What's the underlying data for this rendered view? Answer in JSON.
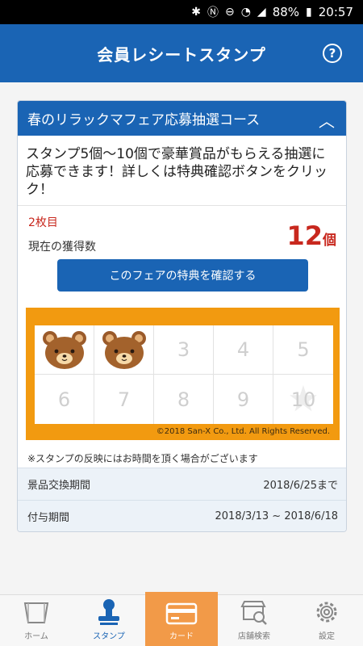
{
  "status": {
    "battery": "88%",
    "time": "20:57"
  },
  "header": {
    "title": "会員レシートスタンプ",
    "help": "?"
  },
  "campaign": {
    "title": "春のリラックマフェア応募抽選コース",
    "description": "スタンプ5個〜10個で豪華賞品がもらえる抽選に応募できます！詳しくは特典確認ボタンをクリック！",
    "sheet": "2枚目",
    "count_label": "現在の獲得数",
    "count": "12",
    "count_unit": "個",
    "button": "このフェアの特典を確認する"
  },
  "stamps": {
    "cells": [
      "",
      "",
      "3",
      "4",
      "5",
      "6",
      "7",
      "8",
      "9",
      "10"
    ],
    "copyright": "©2018 San-X Co., Ltd. All Rights Reserved."
  },
  "note": "※スタンプの反映にはお時間を頂く場合がございます",
  "exchange": {
    "label": "景品交換期間",
    "value": "2018/6/25まで"
  },
  "grant": {
    "label": "付与期間",
    "value": "2018/3/13 ~ 2018/6/18"
  },
  "nav": [
    {
      "label": "ホーム"
    },
    {
      "label": "スタンプ"
    },
    {
      "label": "カード"
    },
    {
      "label": "店舗検索"
    },
    {
      "label": "設定"
    }
  ]
}
